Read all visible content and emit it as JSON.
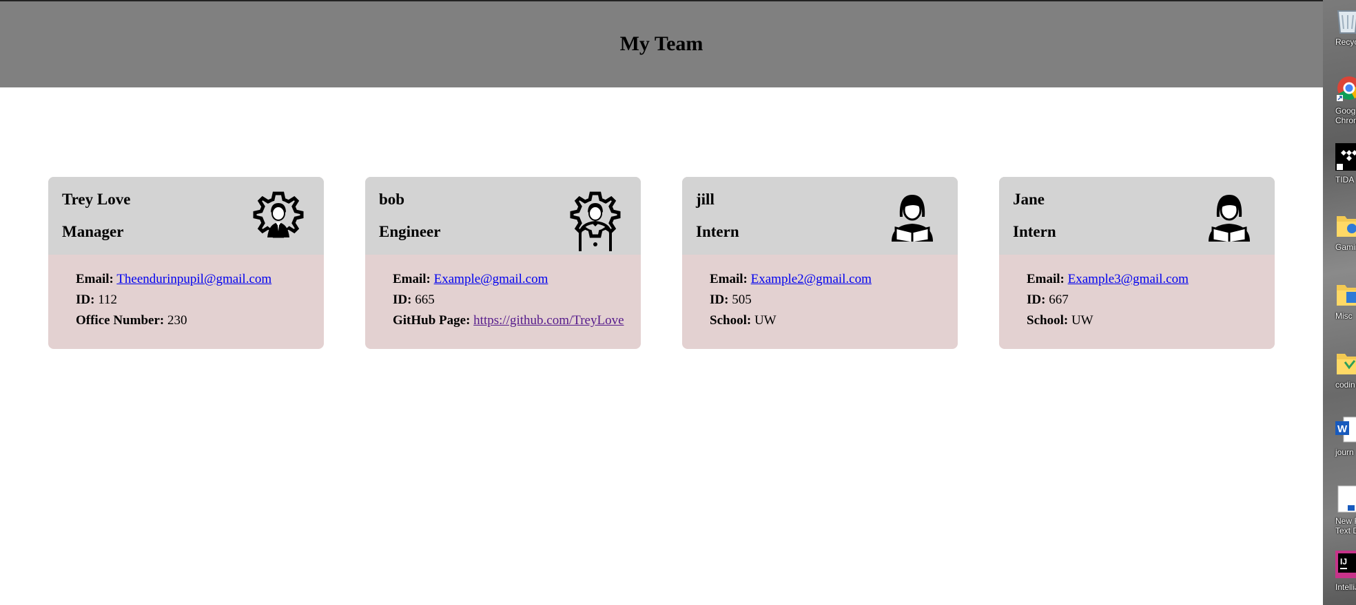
{
  "header": {
    "title": "My Team"
  },
  "cards": [
    {
      "name": "Trey Love",
      "role": "Manager",
      "icon": "manager-gear-person-icon",
      "email_label": "Email:",
      "email": "Theendurinpupil@gmail.com",
      "id_label": "ID:",
      "id": "112",
      "extra_label": "Office Number:",
      "extra_value": "230"
    },
    {
      "name": "bob",
      "role": "Engineer",
      "icon": "engineer-gear-person-icon",
      "email_label": "Email:",
      "email": "Example@gmail.com",
      "id_label": "ID:",
      "id": "665",
      "extra_label": "GitHub Page:",
      "extra_value": "https://github.com/TreyLove"
    },
    {
      "name": "jill",
      "role": "Intern",
      "icon": "student-reading-icon",
      "email_label": "Email:",
      "email": "Example2@gmail.com",
      "id_label": "ID:",
      "id": "505",
      "extra_label": "School:",
      "extra_value": "UW"
    },
    {
      "name": "Jane",
      "role": "Intern",
      "icon": "student-reading-icon",
      "email_label": "Email:",
      "email": "Example3@gmail.com",
      "id_label": "ID:",
      "id": "667",
      "extra_label": "School:",
      "extra_value": "UW"
    }
  ],
  "desktop": {
    "icons": [
      {
        "label": "Recycle",
        "icon": "recycle-bin-icon"
      },
      {
        "label": "Goog\nChron",
        "icon": "chrome-icon"
      },
      {
        "label": "TIDA",
        "icon": "tidal-icon"
      },
      {
        "label": "Gamir",
        "icon": "folder-icon"
      },
      {
        "label": "Misc",
        "icon": "folder-icon"
      },
      {
        "label": "codin",
        "icon": "folder-icon"
      },
      {
        "label": "journ",
        "icon": "word-doc-icon"
      },
      {
        "label": "New R\nText Do",
        "icon": "text-doc-icon"
      },
      {
        "label": "IntelliJ",
        "icon": "intellij-icon"
      }
    ]
  },
  "colors": {
    "header_bg": "#808080",
    "card_head_bg": "#d3d3d3",
    "card_body_bg": "#e3d1d1",
    "link": "#0000ee",
    "visited_link": "#551a8b"
  }
}
